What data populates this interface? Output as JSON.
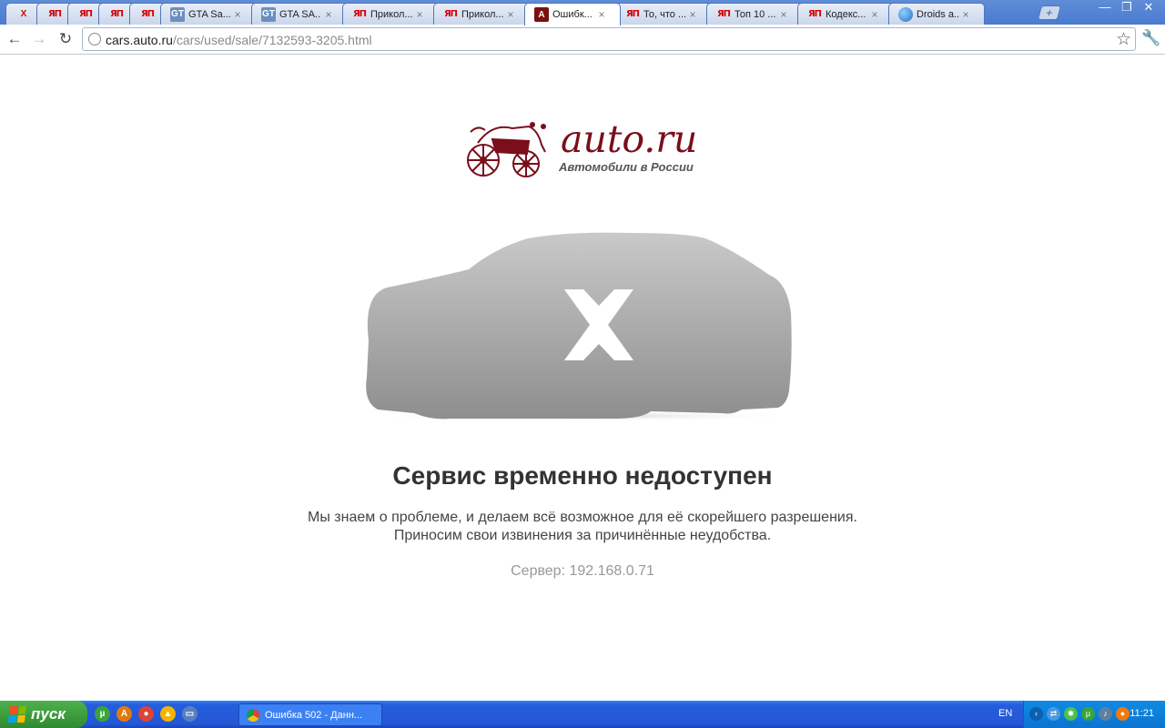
{
  "browser": {
    "tabs": [
      {
        "favicon": "x-icon",
        "glyph": "X",
        "label": "",
        "pinned": true
      },
      {
        "favicon": "yaplakal-icon",
        "glyph": "ЯП",
        "label": "",
        "pinned": true
      },
      {
        "favicon": "yaplakal-icon",
        "glyph": "ЯП",
        "label": "",
        "pinned": true
      },
      {
        "favicon": "yaplakal-icon",
        "glyph": "ЯП",
        "label": "",
        "pinned": true
      },
      {
        "favicon": "yaplakal-icon",
        "glyph": "ЯП",
        "label": "",
        "pinned": true
      },
      {
        "favicon": "gta-icon",
        "glyph": "GT",
        "label": "GTA Sa...",
        "pinned": false
      },
      {
        "favicon": "gta-icon",
        "glyph": "GT",
        "label": "GTA SA...",
        "pinned": false
      },
      {
        "favicon": "yaplakal-icon",
        "glyph": "ЯП",
        "label": "Прикол...",
        "pinned": false
      },
      {
        "favicon": "yaplakal-icon",
        "glyph": "ЯП",
        "label": "Прикол...",
        "pinned": false
      },
      {
        "favicon": "auto-ru-icon",
        "glyph": "A",
        "label": "Ошибк...",
        "pinned": false,
        "active": true
      },
      {
        "favicon": "yaplakal-icon",
        "glyph": "ЯП",
        "label": "То, что ...",
        "pinned": false
      },
      {
        "favicon": "yaplakal-icon",
        "glyph": "ЯП",
        "label": "Топ 10 ...",
        "pinned": false
      },
      {
        "favicon": "yaplakal-icon",
        "glyph": "ЯП",
        "label": "Кодекс...",
        "pinned": false
      },
      {
        "favicon": "globe-icon",
        "glyph": "",
        "label": "Droids a...",
        "pinned": false
      }
    ],
    "close_glyph": "×",
    "new_tab_glyph": "+",
    "window_buttons": [
      "—",
      "❐",
      "✕"
    ],
    "back_glyph": "←",
    "forward_glyph": "→",
    "reload_glyph": "↻",
    "url_host": "cars.auto.ru",
    "url_path": "/cars/used/sale/7132593-3205.html",
    "star_glyph": "☆",
    "wrench_glyph": "🔧"
  },
  "page": {
    "logo_text": "auto.ru",
    "logo_subtitle": "Автомобили в России",
    "title": "Сервис временно недоступен",
    "message_line1": "Мы знаем о проблеме, и делаем всё возможное для её скорейшего разрешения.",
    "message_line2": "Приносим свои извинения за причинённые неудобства.",
    "server": "Сервер: 192.168.0.71",
    "brand_color": "#7a0e1a"
  },
  "taskbar": {
    "start_label": "пуск",
    "quicklaunch": [
      {
        "name": "utorrent-icon",
        "color": "#3aa33a",
        "glyph": "µ"
      },
      {
        "name": "aimp-icon",
        "color": "#e07a10",
        "glyph": "A"
      },
      {
        "name": "chrome-icon",
        "color": "#db4437",
        "glyph": "●"
      },
      {
        "name": "gdrive-icon",
        "color": "#f4b400",
        "glyph": "▲"
      },
      {
        "name": "desktop-icon",
        "color": "#5a7fc0",
        "glyph": "▭"
      }
    ],
    "task_label": "Ошибка 502 - Данн...",
    "lang": "EN",
    "tray": [
      {
        "name": "chevron-left-icon",
        "color": "#0a5fb0",
        "glyph": "‹"
      },
      {
        "name": "network-icon",
        "color": "#4a9be0",
        "glyph": "⇄"
      },
      {
        "name": "clover-icon",
        "color": "#4cc04c",
        "glyph": "✱"
      },
      {
        "name": "utorrent-tray-icon",
        "color": "#3aa33a",
        "glyph": "µ"
      },
      {
        "name": "speaker-icon",
        "color": "#6080a0",
        "glyph": "♪"
      },
      {
        "name": "orange-app-icon",
        "color": "#f07a10",
        "glyph": "●"
      }
    ],
    "clock": "11:21"
  }
}
